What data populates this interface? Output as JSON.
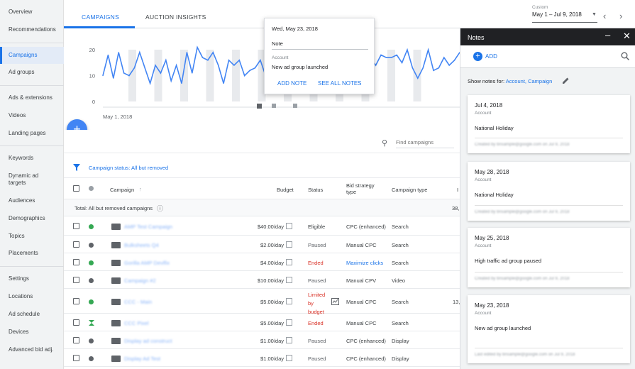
{
  "sidebar": {
    "items": [
      {
        "label": "Overview"
      },
      {
        "label": "Recommendations"
      },
      {
        "label": "Campaigns"
      },
      {
        "label": "Ad groups"
      },
      {
        "label": "Ads & extensions"
      },
      {
        "label": "Videos"
      },
      {
        "label": "Landing pages"
      },
      {
        "label": "Keywords"
      },
      {
        "label": "Dynamic ad targets"
      },
      {
        "label": "Audiences"
      },
      {
        "label": "Demographics"
      },
      {
        "label": "Topics"
      },
      {
        "label": "Placements"
      },
      {
        "label": "Settings"
      },
      {
        "label": "Locations"
      },
      {
        "label": "Ad schedule"
      },
      {
        "label": "Devices"
      },
      {
        "label": "Advanced bid adj."
      }
    ]
  },
  "tabs": [
    {
      "label": "CAMPAIGNS"
    },
    {
      "label": "AUCTION INSIGHTS"
    }
  ],
  "date_range": {
    "label": "Custom",
    "value": "May 1 – Jul 9, 2018"
  },
  "chart": {
    "yticks": [
      "20",
      "10",
      "0"
    ],
    "xlabel": "May 1, 2018"
  },
  "chart_data": {
    "type": "line",
    "ylim": [
      0,
      25
    ],
    "x_start_label": "May 1, 2018",
    "values": [
      10,
      18,
      9,
      19,
      11,
      10,
      13,
      19,
      13,
      7,
      14,
      11,
      16,
      8,
      14,
      7,
      19,
      11,
      21,
      17,
      16,
      19,
      14,
      7,
      16,
      14,
      16,
      10,
      12,
      13,
      16,
      10,
      11,
      16,
      18,
      17,
      17,
      14,
      13,
      16,
      14,
      13,
      18,
      13,
      19,
      15,
      13,
      10,
      14,
      16,
      15,
      17,
      14,
      18,
      17,
      17,
      18,
      15,
      20,
      13,
      9,
      13,
      20,
      12,
      13,
      17,
      14,
      16,
      19
    ]
  },
  "tooltip": {
    "date": "Wed, May 23, 2018",
    "note_label": "Note",
    "account_label": "Account",
    "account_text": "New ad group launched",
    "add_note": "ADD NOTE",
    "see_all": "SEE ALL NOTES"
  },
  "search": {
    "placeholder": "Find campaigns"
  },
  "filter": {
    "label": "Campaign status:",
    "value": "All but removed"
  },
  "table": {
    "headers": {
      "campaign": "Campaign",
      "budget": "Budget",
      "status": "Status",
      "bid": "Bid strategy type",
      "type": "Campaign type",
      "extra": "I"
    },
    "total": {
      "label": "Total: All but removed campaigns",
      "value": "38,"
    },
    "rows": [
      {
        "name": "AMP Test Campaign",
        "budget": "$40.00/day",
        "status": "Eligible",
        "status_color": "#3c4043",
        "bid": "CPC (enhanced)",
        "type": "Search",
        "dot": "#34a853",
        "extra": ""
      },
      {
        "name": "Bulksheets Q4",
        "budget": "$2.00/day",
        "status": "Paused",
        "status_color": "#5f6368",
        "bid": "Manual CPC",
        "type": "Search",
        "dot": "#5f6368",
        "extra": ""
      },
      {
        "name": "Gorilla AMP Devlfix",
        "budget": "$4.00/day",
        "status": "Ended",
        "status_color": "#d93025",
        "bid": "Maximize clicks",
        "type": "Search",
        "dot": "#34a853",
        "extra": ""
      },
      {
        "name": "Campaign #2",
        "budget": "$10.00/day",
        "status": "Paused",
        "status_color": "#5f6368",
        "bid": "Manual CPV",
        "type": "Video",
        "dot": "#5f6368",
        "extra": ""
      },
      {
        "name": "CCC - Main",
        "budget": "$5.00/day",
        "status": "Limited by budget",
        "status_color": "#d93025",
        "bid": "Manual CPC",
        "type": "Search",
        "dot": "#34a853",
        "extra": "13,"
      },
      {
        "name": "CCC Pixel",
        "budget": "$5.00/day",
        "status": "Ended",
        "status_color": "#d93025",
        "bid": "Manual CPC",
        "type": "Search",
        "dot": "#34a853",
        "extra": ""
      },
      {
        "name": "Display ad construct",
        "budget": "$1.00/day",
        "status": "Paused",
        "status_color": "#5f6368",
        "bid": "CPC (enhanced)",
        "type": "Display",
        "dot": "#5f6368",
        "extra": ""
      },
      {
        "name": "Display Ad Test",
        "budget": "$1.00/day",
        "status": "Paused",
        "status_color": "#5f6368",
        "bid": "CPC (enhanced)",
        "type": "Display",
        "dot": "#5f6368",
        "extra": ""
      }
    ]
  },
  "notes": {
    "title": "Notes",
    "add": "ADD",
    "show_for_label": "Show notes for:",
    "show_for_value": "Account, Campaign",
    "cards": [
      {
        "date": "Jul 4, 2018",
        "scope": "Account",
        "text": "National Holiday",
        "meta": "Created by bnsample@google.com on Jul 9, 2018"
      },
      {
        "date": "May 28, 2018",
        "scope": "Account",
        "text": "National Holiday",
        "meta": "Created by bnsample@google.com on Jul 9, 2018"
      },
      {
        "date": "May 25, 2018",
        "scope": "Account",
        "text": "High traffic ad group paused",
        "meta": "Created by bnsample@google.com on Jul 9, 2018"
      },
      {
        "date": "May 23, 2018",
        "scope": "Account",
        "text": "New ad group launched",
        "meta": "Last edited by bnsample@google.com on Jul 9, 2018"
      }
    ]
  }
}
